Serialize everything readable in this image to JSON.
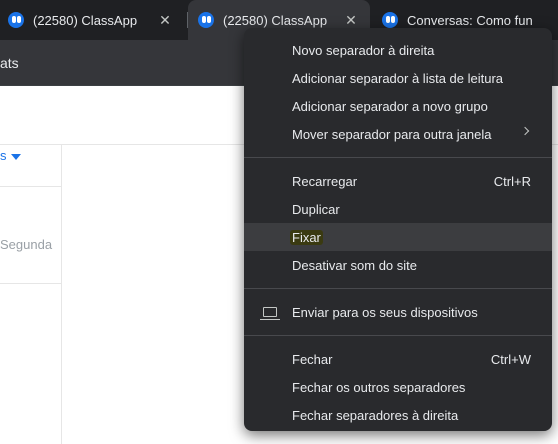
{
  "tabs": [
    {
      "title": "(22580) ClassApp",
      "close": "✕",
      "active": false
    },
    {
      "title": "(22580) ClassApp",
      "close": "✕",
      "active": true
    },
    {
      "title": "Conversas: Como fun",
      "close": "✕",
      "active": false
    }
  ],
  "toolbar": {
    "url_fragment": "ats"
  },
  "page": {
    "filter_fragment": "s",
    "day_fragment": "Segunda"
  },
  "context_menu": {
    "group1": [
      {
        "label": "Novo separador à direita"
      },
      {
        "label": "Adicionar separador à lista de leitura"
      },
      {
        "label": "Adicionar separador a novo grupo"
      },
      {
        "label": "Mover separador para outra janela",
        "submenu": true
      }
    ],
    "group2": [
      {
        "label": "Recarregar",
        "shortcut": "Ctrl+R"
      },
      {
        "label": "Duplicar"
      },
      {
        "label": "Fixar",
        "hovered": true
      },
      {
        "label": "Desativar som do site"
      }
    ],
    "group3": [
      {
        "label": "Enviar para os seus dispositivos",
        "icon": "devices-icon"
      }
    ],
    "group4": [
      {
        "label": "Fechar",
        "shortcut": "Ctrl+W"
      },
      {
        "label": "Fechar os outros separadores"
      },
      {
        "label": "Fechar separadores à direita"
      }
    ]
  },
  "colors": {
    "tabstrip": "#1f2023",
    "active_tab": "#35363a",
    "menu": "#292a2d",
    "accent": "#1a73e8",
    "highlight": "#3a3a11"
  }
}
